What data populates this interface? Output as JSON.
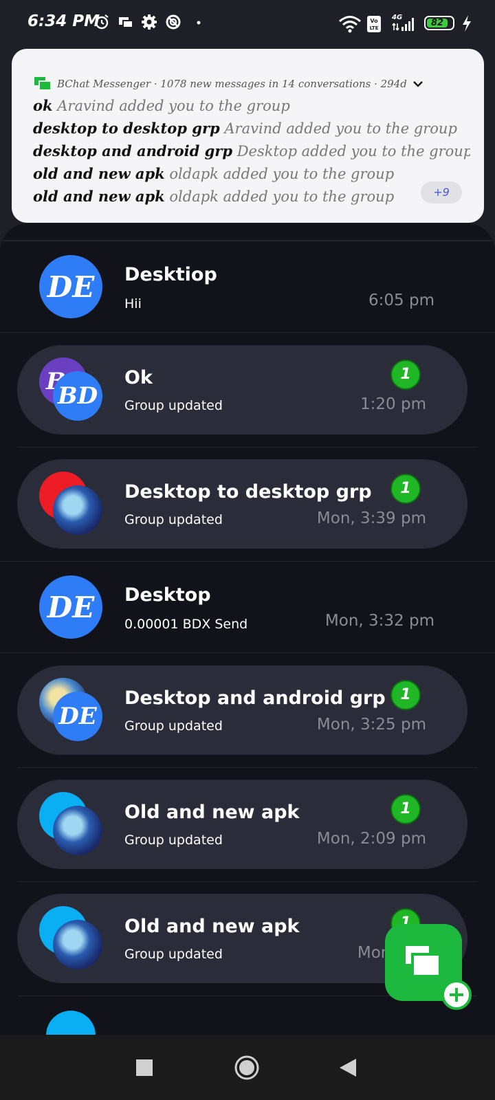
{
  "status_bar": {
    "time": "6:34 PM",
    "network": "4G",
    "battery": "82",
    "battery_level": 0.82,
    "icons": [
      "alarm-icon",
      "cast-icon",
      "settings-icon",
      "data-saver-icon",
      "wifi-icon",
      "volte-icon",
      "signal-icon",
      "charging-icon"
    ]
  },
  "notification": {
    "header": "BChat Messenger · 1078 new messages in 14 conversations · 294d",
    "lines": [
      {
        "who": "ok",
        "msg": "Aravind added you to the group"
      },
      {
        "who": "desktop to desktop grp",
        "msg": "Aravind added you to the group"
      },
      {
        "who": "desktop and android grp",
        "msg": "Desktop added you to the group"
      },
      {
        "who": "old and new apk",
        "msg": "oldapk added you to the group"
      },
      {
        "who": "old and new apk",
        "msg": "oldapk added you to the group"
      }
    ],
    "more": "+9"
  },
  "conversations": [
    {
      "title": "Desktiop",
      "subtitle": "Hii",
      "time": "6:05 pm",
      "avatar": "DE",
      "unread": null
    },
    {
      "title": "Ok",
      "subtitle": "Group updated",
      "time": "1:20 pm",
      "avatar": "BD",
      "unread": "1"
    },
    {
      "title": "Desktop to desktop grp",
      "subtitle": "Group updated",
      "time": "Mon, 3:39 pm",
      "avatar": "",
      "unread": "1"
    },
    {
      "title": "Desktop",
      "subtitle": "0.00001 BDX Send",
      "time": "Mon, 3:32 pm",
      "avatar": "DE",
      "unread": null
    },
    {
      "title": "Desktop and android grp",
      "subtitle": "Group updated",
      "time": "Mon, 3:25 pm",
      "avatar": "DE",
      "unread": "1"
    },
    {
      "title": "Old and new apk",
      "subtitle": "Group updated",
      "time": "Mon, 2:09 pm",
      "avatar": "",
      "unread": "1"
    },
    {
      "title": "Old and new apk",
      "subtitle": "Group updated",
      "time": "Mon, 2:0",
      "avatar": "",
      "unread": "1"
    }
  ],
  "colors": {
    "accent": "#1cb93e",
    "avatar_blue": "#2f7df6",
    "badge_green": "#1fb725"
  }
}
